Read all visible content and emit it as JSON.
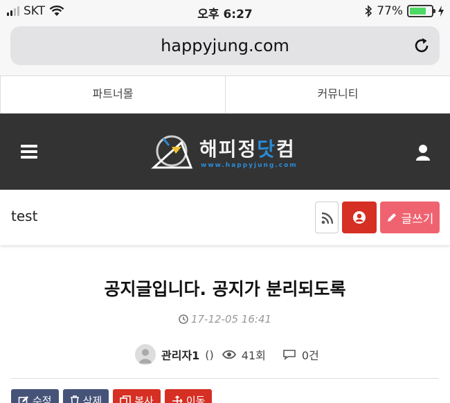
{
  "status_bar": {
    "carrier": "SKT",
    "time": "오후 6:27",
    "battery": "77%",
    "battery_level": 0.77
  },
  "browser": {
    "url": "happyjung.com"
  },
  "top_nav": {
    "items": [
      {
        "label": "파트너몰"
      },
      {
        "label": "커뮤니티"
      }
    ]
  },
  "site_header": {
    "logo_name_part1": "해피정",
    "logo_name_accent": "닷",
    "logo_name_part2": "컴",
    "logo_url": "www.happyjung.com",
    "bg_color": "#333333",
    "accent_color": "#2a8bd6"
  },
  "board": {
    "title": "test",
    "write_label": "글쓰기"
  },
  "post": {
    "title": "공지글입니다. 공지가 분리되도록",
    "date": "17-12-05 16:41",
    "author": "관리자1",
    "author_suffix": "()",
    "views": "41회",
    "comments": "0건"
  },
  "actions": {
    "edit": "수정",
    "delete": "삭제",
    "copy": "복사",
    "move": "이동"
  }
}
